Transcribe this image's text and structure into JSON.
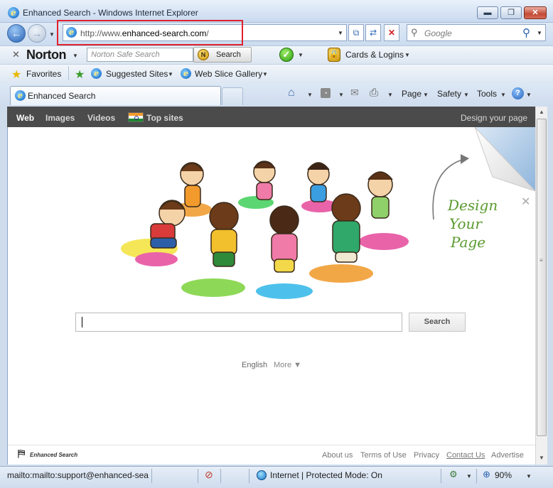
{
  "window": {
    "title": "Enhanced Search - Windows Internet Explorer",
    "minimize": "▬",
    "restore": "❐",
    "close": "✕"
  },
  "nav": {
    "address": "http://www.enhanced-search.com/",
    "address_prefix": "http://www.",
    "address_domain": "enhanced-search.com",
    "address_suffix": "/",
    "search_placeholder": "Google"
  },
  "norton": {
    "brand": "Norton",
    "search_placeholder": "Norton Safe Search",
    "search_button": "Search",
    "coin_letter": "N",
    "cards_logins": "Cards & Logins"
  },
  "favorites": {
    "favorites_label": "Favorites",
    "suggested_sites": "Suggested Sites",
    "web_slice_gallery": "Web Slice Gallery"
  },
  "tab": {
    "title": "Enhanced Search"
  },
  "commandbar": {
    "page": "Page",
    "safety": "Safety",
    "tools": "Tools",
    "help": "?"
  },
  "site": {
    "nav": [
      "Web",
      "Images",
      "Videos",
      "Top sites"
    ],
    "design_your_page": "Design your page",
    "design_corner": [
      "Design",
      "Your",
      "Page"
    ],
    "search_button": "Search",
    "language": "English",
    "more": "More ▼",
    "logo": "Enhanced Search",
    "footer": [
      "About us",
      "Terms of Use",
      "Privacy",
      "Contact Us",
      "Advertise"
    ]
  },
  "status": {
    "link": "mailto:mailto:support@enhanced-sea",
    "zone": "Internet | Protected Mode: On",
    "zoom": "90%"
  },
  "colors": {
    "highlight_box": "#e0212e",
    "dark_nav": "#4b4b4b",
    "design_green": "#5a9a2e"
  }
}
